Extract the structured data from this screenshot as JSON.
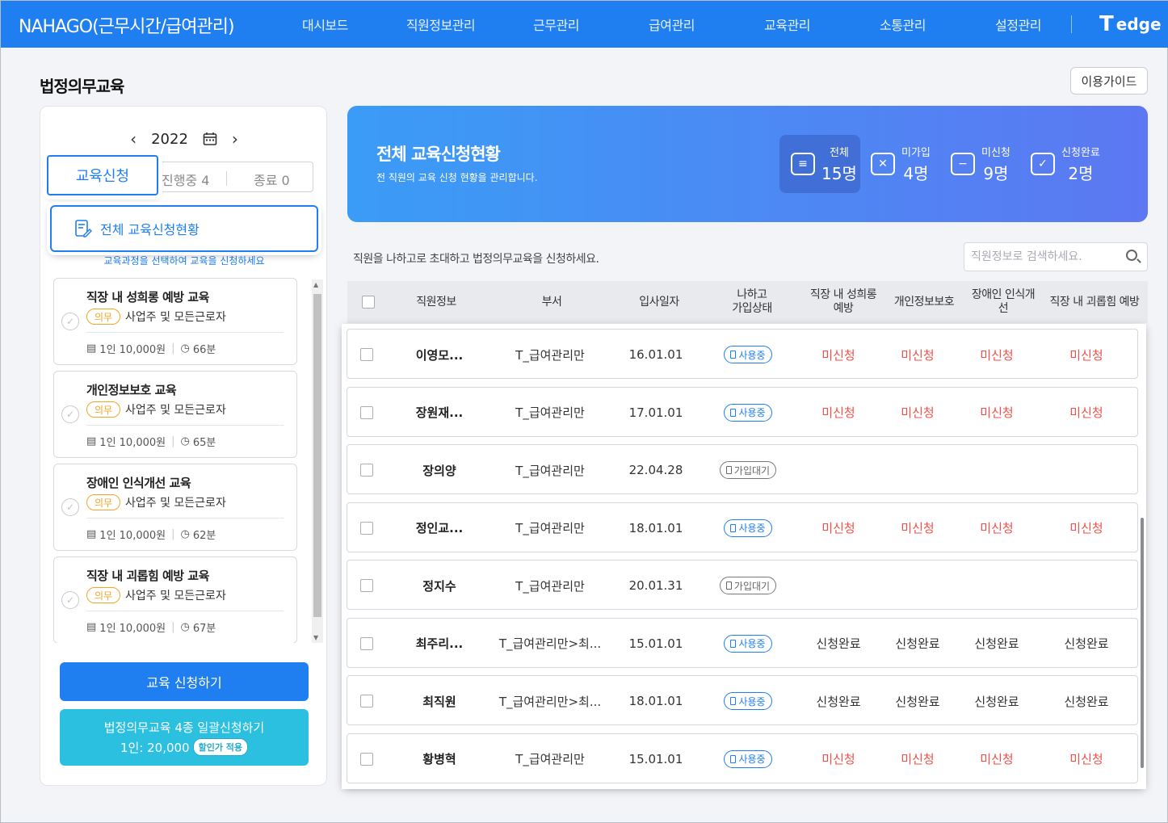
{
  "header": {
    "brand": "NAHAGO(근무시간/급여관리)",
    "nav": [
      "대시보드",
      "직원정보관리",
      "근무관리",
      "급여관리",
      "교육관리",
      "소통관리",
      "설정관리"
    ],
    "partner_t": "T",
    "partner_name": "edge"
  },
  "page": {
    "title": "법정의무교육",
    "guide_label": "이용가이드"
  },
  "left": {
    "year": "2022",
    "prev_icon": "chevron-left-icon",
    "next_icon": "chevron-right-icon",
    "tab_apply": "교육신청",
    "tab_progress": "진행중 4",
    "tab_done": "종료 0",
    "overview_label": "전체 교육신청현황",
    "hint": "교육과정을 선택하여 교육을 신청하세요",
    "courses": [
      {
        "name": "직장 내 성희롱 예방 교육",
        "badge": "의무",
        "target": "사업주 및 모든근로자",
        "price": "1인 10,000원",
        "duration": "66분"
      },
      {
        "name": "개인정보보호 교육",
        "badge": "의무",
        "target": "사업주 및 모든근로자",
        "price": "1인 10,000원",
        "duration": "65분"
      },
      {
        "name": "장애인 인식개선 교육",
        "badge": "의무",
        "target": "사업주 및 모든근로자",
        "price": "1인 10,000원",
        "duration": "62분"
      },
      {
        "name": "직장 내 괴롭힘 예방 교육",
        "badge": "의무",
        "target": "사업주 및 모든근로자",
        "price": "1인 10,000원",
        "duration": "67분"
      }
    ],
    "apply_button": "교육 신청하기",
    "bundle_line1": "법정의무교육 4종 일괄신청하기",
    "bundle_line2": "1인: 20,000",
    "bundle_pill": "할인가 적용"
  },
  "summary": {
    "title": "전체 교육신청현황",
    "subtitle": "전 직원의 교육 신청 현황을 관리합니다.",
    "stats": [
      {
        "label": "전체",
        "value": "15명",
        "icon": "list-icon"
      },
      {
        "label": "미가입",
        "value": "4명",
        "icon": "x-box-icon"
      },
      {
        "label": "미신청",
        "value": "9명",
        "icon": "minus-box-icon"
      },
      {
        "label": "신청완료",
        "value": "2명",
        "icon": "check-box-icon"
      }
    ]
  },
  "table": {
    "instruction": "직원을 나하고로 초대하고 법정의무교육을 신청하세요.",
    "search_placeholder": "직원정보로 검색하세요.",
    "headers": {
      "info": "직원정보",
      "dept": "부서",
      "hired": "입사일자",
      "status_l1": "나하고",
      "status_l2": "가입상태",
      "c1_l1": "직장 내 성희롱",
      "c1_l2": "예방",
      "c2": "개인정보보호",
      "c3_l1": "장애인 인식개",
      "c3_l2": "선",
      "c4": "직장 내 괴롭힘 예방"
    },
    "rows": [
      {
        "name": "이영모...",
        "dept": "T_급여관리만",
        "hired": "16.01.01",
        "status": "사용중",
        "c1": "미신청",
        "c2": "미신청",
        "c3": "미신청",
        "c4": "미신청"
      },
      {
        "name": "장원재...",
        "dept": "T_급여관리만",
        "hired": "17.01.01",
        "status": "사용중",
        "c1": "미신청",
        "c2": "미신청",
        "c3": "미신청",
        "c4": "미신청"
      },
      {
        "name": "장의양",
        "dept": "T_급여관리만",
        "hired": "22.04.28",
        "status": "가입대기",
        "c1": "",
        "c2": "",
        "c3": "",
        "c4": ""
      },
      {
        "name": "정인교...",
        "dept": "T_급여관리만",
        "hired": "18.01.01",
        "status": "사용중",
        "c1": "미신청",
        "c2": "미신청",
        "c3": "미신청",
        "c4": "미신청"
      },
      {
        "name": "정지수",
        "dept": "T_급여관리만",
        "hired": "20.01.31",
        "status": "가입대기",
        "c1": "",
        "c2": "",
        "c3": "",
        "c4": ""
      },
      {
        "name": "최주리...",
        "dept": "T_급여관리만>최...",
        "hired": "15.01.01",
        "status": "사용중",
        "c1": "신청완료",
        "c2": "신청완료",
        "c3": "신청완료",
        "c4": "신청완료"
      },
      {
        "name": "최직원",
        "dept": "T_급여관리만>최...",
        "hired": "18.01.01",
        "status": "사용중",
        "c1": "신청완료",
        "c2": "신청완료",
        "c3": "신청완료",
        "c4": "신청완료"
      },
      {
        "name": "황병혁",
        "dept": "T_급여관리만",
        "hired": "15.01.01",
        "status": "사용중",
        "c1": "미신청",
        "c2": "미신청",
        "c3": "미신청",
        "c4": "미신청"
      }
    ]
  },
  "colors": {
    "primary": "#1f7ef0",
    "bundle": "#2cc0e0",
    "badge_orange": "#f5a523",
    "not_applied_red": "#f0504a"
  }
}
